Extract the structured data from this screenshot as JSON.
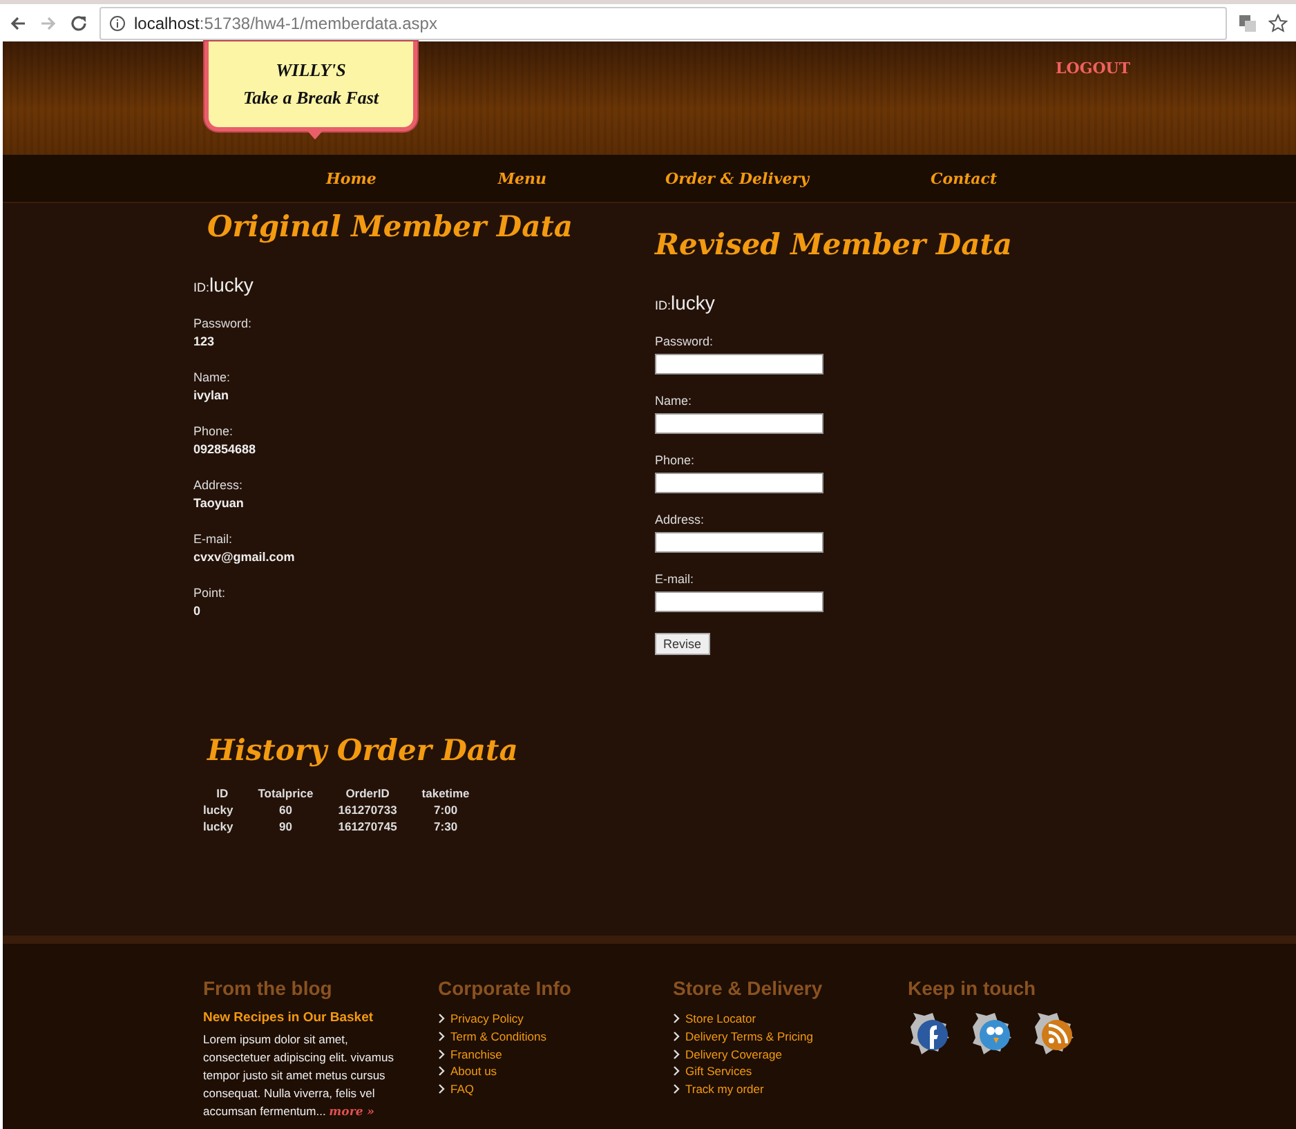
{
  "browser": {
    "url_host": "localhost",
    "url_path": ":51738/hw4-1/memberdata.aspx"
  },
  "header": {
    "logo": {
      "line_1": "WILLY'S",
      "line_2": "Take a Break Fast"
    },
    "logout": "LOGOUT"
  },
  "nav": [
    "Home",
    "Menu",
    "Order & Delivery",
    "Contact"
  ],
  "original": {
    "title": "Original Member Data",
    "id_label": "ID:",
    "id_value": "lucky",
    "fields": [
      {
        "label": "Password:",
        "value": "123"
      },
      {
        "label": "Name:",
        "value": "ivylan"
      },
      {
        "label": "Phone:",
        "value": "092854688"
      },
      {
        "label": "Address:",
        "value": "Taoyuan"
      },
      {
        "label": "E-mail:",
        "value": "cvxv@gmail.com"
      },
      {
        "label": "Point:",
        "value": "0"
      }
    ]
  },
  "revised": {
    "title": "Revised Member Data",
    "id_label": "ID:",
    "id_value": "lucky",
    "fields": [
      {
        "label": "Password:"
      },
      {
        "label": "Name:"
      },
      {
        "label": "Phone:"
      },
      {
        "label": "Address:"
      },
      {
        "label": "E-mail:"
      }
    ],
    "button": "Revise"
  },
  "history": {
    "title": "History Order Data",
    "columns": [
      "ID",
      "Totalprice",
      "OrderID",
      "taketime"
    ],
    "rows": [
      [
        "lucky",
        "60",
        "161270733",
        "7:00"
      ],
      [
        "lucky",
        "90",
        "161270745",
        "7:30"
      ]
    ]
  },
  "footer": {
    "blog": {
      "title": "From the blog",
      "post_title": "New Recipes in Our Basket",
      "text": "Lorem ipsum dolor sit amet, consectetuer adipiscing elit. vivamus tempor justo sit amet metus cursus consequat. Nulla viverra, felis vel accumsan fermentum...",
      "more": "more »"
    },
    "corporate": {
      "title": "Corporate Info",
      "links": [
        "Privacy Policy",
        "Term & Conditions",
        "Franchise",
        "About us",
        "FAQ"
      ]
    },
    "store": {
      "title": "Store & Delivery",
      "links": [
        "Store Locator",
        "Delivery Terms & Pricing",
        "Delivery Coverage",
        "Gift Services",
        "Track my order"
      ]
    },
    "social": {
      "title": "Keep in touch",
      "icons": [
        {
          "kind": "facebook"
        },
        {
          "kind": "bird"
        },
        {
          "kind": "rss"
        }
      ]
    }
  }
}
